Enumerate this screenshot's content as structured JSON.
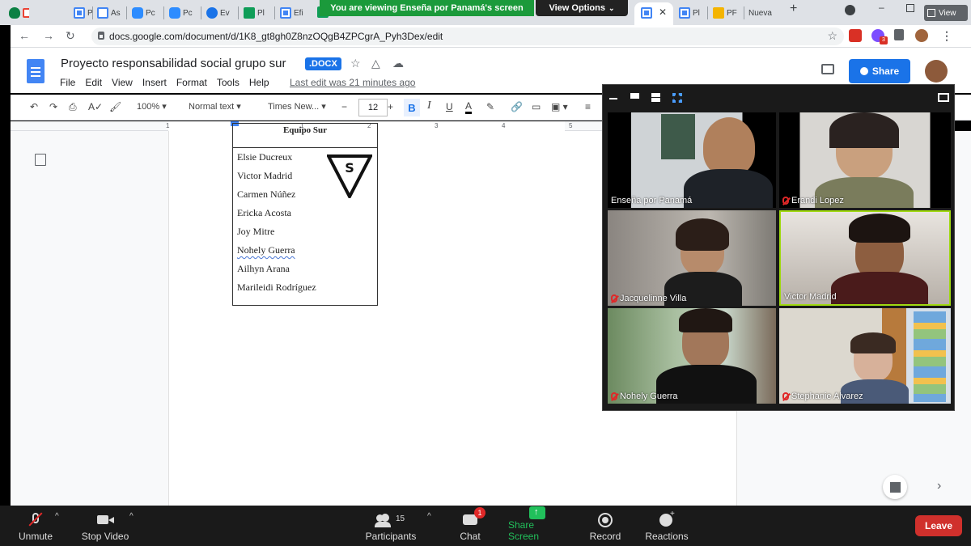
{
  "browser": {
    "tabs": [
      {
        "label": "Pr",
        "icon": "docs-icon"
      },
      {
        "label": "As",
        "icon": "calendar-icon"
      },
      {
        "label": "Pc",
        "icon": "zoom-icon"
      },
      {
        "label": "Pc",
        "icon": "zoom-icon"
      },
      {
        "label": "Ev",
        "icon": "earth-icon"
      },
      {
        "label": "Pl",
        "icon": "sheets-icon"
      },
      {
        "label": "Efi",
        "icon": "docs-icon"
      },
      {
        "label": "Pl",
        "icon": "docs-icon"
      },
      {
        "label": "PF",
        "icon": "slides-icon"
      },
      {
        "label": "Nueva",
        "icon": "new-tab-icon"
      }
    ],
    "view_chip": "View",
    "url": "docs.google.com/document/d/1K8_gt8gh0Z8nzOQgB4ZPCgrA_Pyh3Dex/edit",
    "extension_badge": "3"
  },
  "zoom_banner": {
    "text": "You are viewing Enseña por Panamá's screen",
    "view_options": "View Options"
  },
  "docs": {
    "title": "Proyecto responsabilidad social grupo sur",
    "badge": ".DOCX",
    "menu": [
      "File",
      "Edit",
      "View",
      "Insert",
      "Format",
      "Tools",
      "Help"
    ],
    "last_edit": "Last edit was 21 minutes ago",
    "share_label": "Share",
    "zoom_level": "100%",
    "style_select": "Normal text",
    "font_select": "Times New...",
    "font_size": "12",
    "ruler_numbers": [
      "1",
      "1",
      "2",
      "3",
      "4",
      "5"
    ],
    "team_heading": "Equipo Sur",
    "members": [
      "Elsie Ducreux",
      "Victor Madrid",
      "Carmen Núñez",
      "Ericka Acosta",
      "Joy Mitre",
      "Nohely Guerra",
      "Ailhyn Arana",
      "Marileidi Rodríguez"
    ]
  },
  "gallery": {
    "participants": [
      {
        "name": "Enseña por Panamá",
        "muted": false
      },
      {
        "name": "Erandi Lopez",
        "muted": true
      },
      {
        "name": "Jacquelinne Villa",
        "muted": true
      },
      {
        "name": "Victor Madrid",
        "muted": false
      },
      {
        "name": "Nohely Guerra",
        "muted": true
      },
      {
        "name": "Stephanie Alvarez",
        "muted": true
      }
    ]
  },
  "controls": {
    "unmute": "Unmute",
    "stop_video": "Stop Video",
    "participants": "Participants",
    "participant_count": "15",
    "chat": "Chat",
    "chat_badge": "1",
    "share_screen": "Share Screen",
    "record": "Record",
    "reactions": "Reactions",
    "leave": "Leave"
  },
  "colors": {
    "share_screen_green": "#21c05b",
    "leave_red": "#d0302c",
    "docs_blue": "#1a73e8",
    "banner_green": "#1b9a3b"
  }
}
